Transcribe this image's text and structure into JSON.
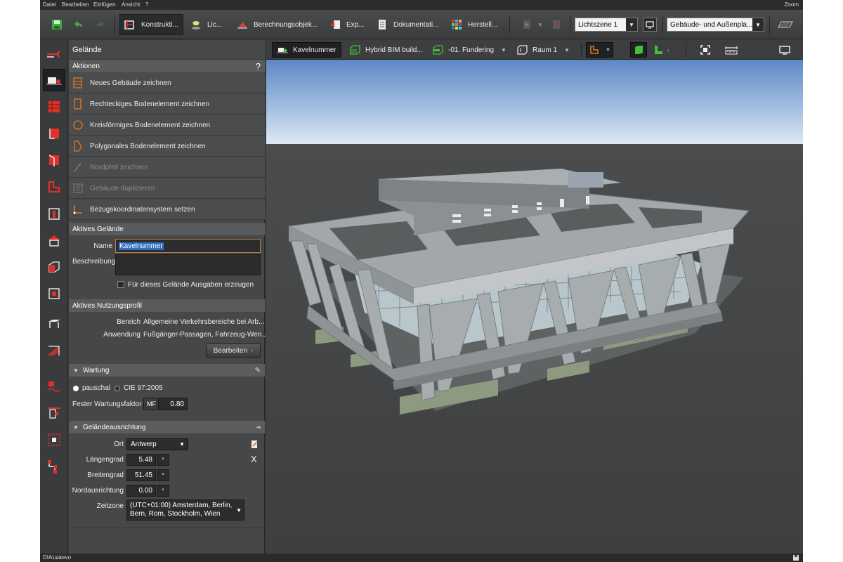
{
  "menu": {
    "items": [
      "Datei",
      "Bearbeiten",
      "Einfügen",
      "Ansicht",
      "?"
    ],
    "zoom": "Zoom"
  },
  "toolbar": {
    "tabs": [
      {
        "label": "Konstrukti...",
        "icon": "construction-icon",
        "active": true
      },
      {
        "label": "Lic...",
        "icon": "light-icon",
        "active": false
      },
      {
        "label": "Berechnungsobjek...",
        "icon": "calculation-icon",
        "active": false
      },
      {
        "label": "Exp...",
        "icon": "export-icon",
        "active": false
      },
      {
        "label": "Dokumentati...",
        "icon": "documentation-icon",
        "active": false
      },
      {
        "label": "Herstell...",
        "icon": "manufacturer-icon",
        "active": false
      }
    ],
    "light_scene": "Lichtszene 1",
    "building_select": "Gebäude- und Außenpla..."
  },
  "panel": {
    "title": "Gelände",
    "actions_header": "Aktionen",
    "help": "?",
    "actions": [
      {
        "label": "Neues Gebäude zeichnen",
        "enabled": true
      },
      {
        "label": "Rechteckiges Bodenelement zeichnen",
        "enabled": true
      },
      {
        "label": "Kreisförmiges Bodenelement zeichnen",
        "enabled": true
      },
      {
        "label": "Polygonales Bodenelement zeichnen",
        "enabled": true
      },
      {
        "label": "Nordpfeil zeichnen",
        "enabled": false
      },
      {
        "label": "Gebäude duplizieren",
        "enabled": false
      },
      {
        "label": "Bezugskoordinatensystem setzen",
        "enabled": true
      }
    ],
    "active_site": {
      "header": "Aktives Gelände",
      "name_label": "Name",
      "name_value": "Kavelnummer",
      "description_label": "Beschreibung",
      "description_value": "",
      "output_checkbox_label": "Für dieses Gelände Ausgaben erzeugen",
      "output_checked": false
    },
    "usage_profile": {
      "header": "Aktives Nutzungsprofil",
      "area_label": "Bereich",
      "area_value": "Allgemeine Verkehrsbereiche bei Arb...",
      "application_label": "Anwendung",
      "application_value": "Fußgänger-Passagen, Fahrzeug-Wen...",
      "edit_button": "Bearbeiten"
    },
    "maintenance": {
      "header": "Wartung",
      "option_flat": "pauschal",
      "option_cie": "CIE 97:2005",
      "selected": "pauschal",
      "factor_label": "Fester Wartungsfaktor",
      "factor_prefix": "MF",
      "factor_value": "0.80"
    },
    "orientation": {
      "header": "Geländeausrichtung",
      "location_label": "Ort",
      "location_value": "Antwerp",
      "longitude_label": "Längengrad",
      "longitude_value": "5.48",
      "latitude_label": "Breitengrad",
      "latitude_value": "51.45",
      "north_label": "Nordausrichtung",
      "north_value": "0.00",
      "degree_symbol": "°",
      "timezone_label": "Zeitzone",
      "timezone_line1": "(UTC+01:00) Amsterdam, Berlin,",
      "timezone_line2": "Bern, Rom, Stockholm, Wien",
      "clear_symbol": "X"
    }
  },
  "view_toolbar": {
    "site": "Kavelnummer",
    "building": "Hybrid BIM build...",
    "storey": "-01. Fundering",
    "room": "Raum 1"
  },
  "status": {
    "app_name_prefix": "DIAL",
    "app_name_bold": "ux",
    "app_name_suffix": "evo"
  },
  "colors": {
    "accent_orange": "#e07a1f",
    "active_green": "#3fc23a",
    "panel_bg": "#464748",
    "sky_top": "#5d88c4"
  }
}
